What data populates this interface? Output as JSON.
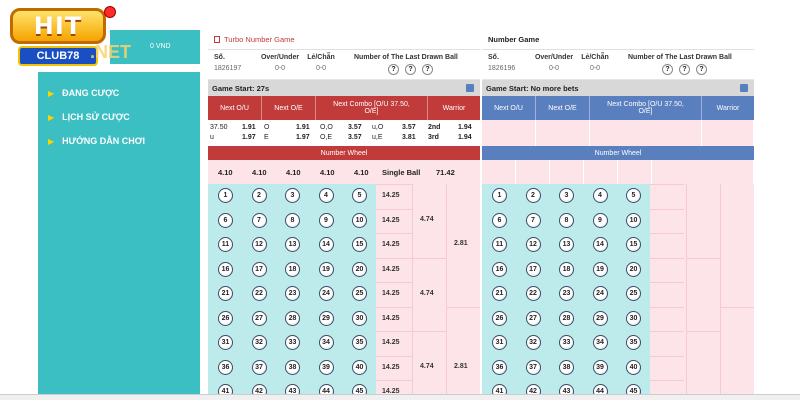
{
  "brand": {
    "logo_top": "HIT",
    "logo_bottom": "CLUB78",
    "domain_suffix": ".NET"
  },
  "balance": "0 VND",
  "menu": [
    {
      "label": "ĐANG CƯỢC",
      "icon": "arrow-right-icon"
    },
    {
      "label": "LỊCH SỬ CƯỢC",
      "icon": "arrow-right-icon"
    },
    {
      "label": "HƯỚNG DẪN CHƠI",
      "icon": "arrow-right-icon"
    }
  ],
  "turbo": {
    "title": "Turbo Number Game",
    "so_label": "Số.",
    "so_value": "1826197",
    "ou_label": "Over/Under",
    "ou_value": "0-0",
    "lc_label": "Lẻ/Chẵn",
    "lc_value": "0-0",
    "last_label": "Number of The Last Drawn Ball",
    "last_balls": [
      "?",
      "?",
      "?"
    ],
    "status": "Game Start: 27s",
    "headers": [
      "Next O/U",
      "Next O/E",
      "Next Combo [O/U 37.50, O/E]",
      "Warrior"
    ],
    "odds": {
      "r1": [
        "37.50",
        "1.91",
        "O",
        "1.91",
        "O,O",
        "3.57",
        "u,O",
        "3.57",
        "2nd",
        "1.94"
      ],
      "r2": [
        "u",
        "1.97",
        "E",
        "1.97",
        "O,E",
        "3.57",
        "u,E",
        "3.81",
        "3rd",
        "1.94"
      ]
    },
    "number_wheel": "Number Wheel",
    "wheel_values": [
      "4.10",
      "4.10",
      "4.10",
      "4.10",
      "4.10"
    ],
    "single_ball_label": "Single Ball",
    "single_ball_value": "71.42",
    "row_odds": "14.25",
    "group_odds": "4.74",
    "big_odds": "2.81"
  },
  "normal": {
    "title": "Number Game",
    "so_label": "Số.",
    "so_value": "1826196",
    "ou_label": "Over/Under",
    "ou_value": "0-0",
    "lc_label": "Lẻ/Chẵn",
    "lc_value": "0-0",
    "last_label": "Number of The Last Drawn Ball",
    "last_balls": [
      "?",
      "?",
      "?"
    ],
    "status": "Game Start: No more bets",
    "headers": [
      "Next O/U",
      "Next O/E",
      "Next Combo [O/U 37.50, O/E]",
      "Warrior"
    ],
    "number_wheel": "Number Wheel"
  },
  "balls": [
    1,
    2,
    3,
    4,
    5,
    6,
    7,
    8,
    9,
    10,
    11,
    12,
    13,
    14,
    15,
    16,
    17,
    18,
    19,
    20,
    21,
    22,
    23,
    24,
    25,
    26,
    27,
    28,
    29,
    30,
    31,
    32,
    33,
    34,
    35,
    36,
    37,
    38,
    39,
    40,
    41,
    42,
    43,
    44,
    45
  ],
  "colors": {
    "turbo_red": "#c23b3b",
    "normal_blue": "#5a7fbf",
    "teal": "#3bbfc3",
    "pink": "#fde4e8",
    "ball_bg": "#bdeaea"
  }
}
